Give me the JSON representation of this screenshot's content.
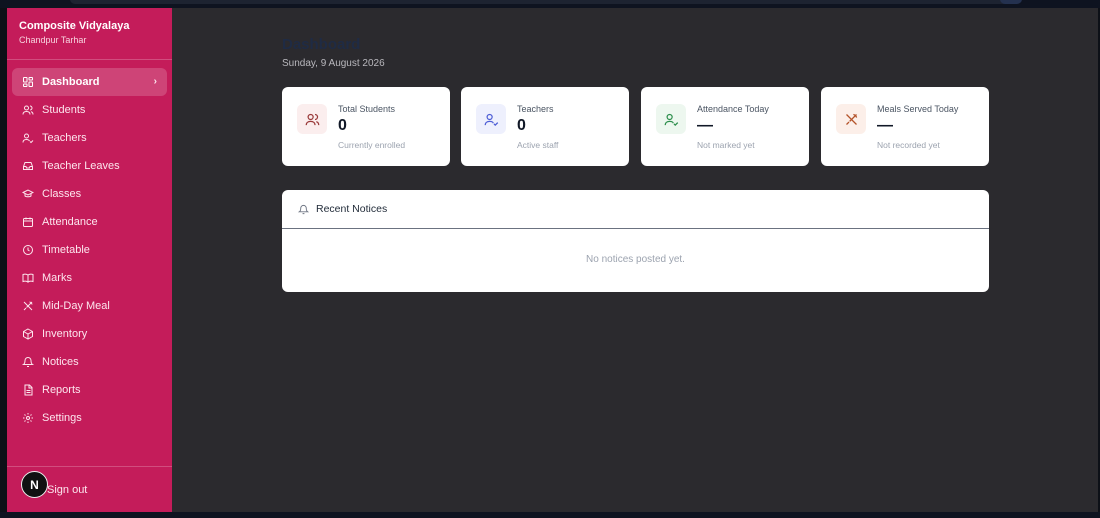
{
  "brand": {
    "name": "Composite Vidyalaya",
    "subtitle": "Chandpur Tarhar"
  },
  "sidebar": {
    "items": [
      {
        "label": "Dashboard",
        "icon": "dashboard-grid-icon",
        "active": true
      },
      {
        "label": "Students",
        "icon": "users-icon"
      },
      {
        "label": "Teachers",
        "icon": "user-check-icon"
      },
      {
        "label": "Teacher Leaves",
        "icon": "inbox-icon"
      },
      {
        "label": "Classes",
        "icon": "graduation-cap-icon"
      },
      {
        "label": "Attendance",
        "icon": "calendar-icon"
      },
      {
        "label": "Timetable",
        "icon": "clock-icon"
      },
      {
        "label": "Marks",
        "icon": "book-icon"
      },
      {
        "label": "Mid-Day Meal",
        "icon": "utensils-icon"
      },
      {
        "label": "Inventory",
        "icon": "box-icon"
      },
      {
        "label": "Notices",
        "icon": "bell-icon"
      },
      {
        "label": "Reports",
        "icon": "file-icon"
      },
      {
        "label": "Settings",
        "icon": "gear-icon"
      }
    ],
    "signout_label": "Sign out",
    "badge_letter": "N"
  },
  "header": {
    "title": "Dashboard",
    "date": "Sunday, 9 August 2026"
  },
  "stats": [
    {
      "label": "Total Students",
      "value": "0",
      "sub": "Currently enrolled",
      "icon": "users-icon",
      "tint": "#fbeeee",
      "color": "#9a3b3b"
    },
    {
      "label": "Teachers",
      "value": "0",
      "sub": "Active staff",
      "icon": "user-check-icon",
      "tint": "#eef0fd",
      "color": "#4f5fd6"
    },
    {
      "label": "Attendance Today",
      "value": "—",
      "sub": "Not marked yet",
      "icon": "user-check-icon",
      "tint": "#edf7ef",
      "color": "#2f8f4e"
    },
    {
      "label": "Meals Served Today",
      "value": "—",
      "sub": "Not recorded yet",
      "icon": "utensils-icon",
      "tint": "#fcefe9",
      "color": "#b4532a"
    }
  ],
  "notices": {
    "title": "Recent Notices",
    "empty_text": "No notices posted yet."
  },
  "colors": {
    "sidebar": "#c41c5a",
    "background": "#2b2a2e"
  }
}
